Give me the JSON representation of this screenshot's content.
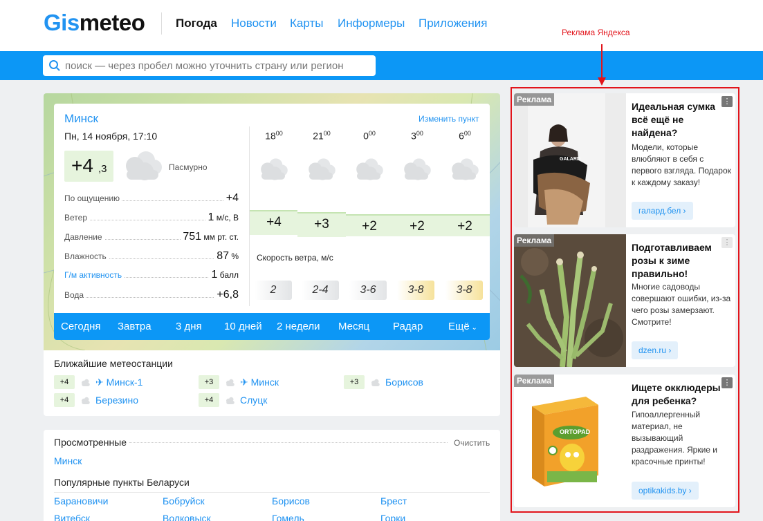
{
  "header": {
    "logo_part1": "Gis",
    "logo_part2": "meteo",
    "nav": [
      "Погода",
      "Новости",
      "Карты",
      "Информеры",
      "Приложения"
    ]
  },
  "search": {
    "placeholder": "поиск — через пробел можно уточнить страну или регион"
  },
  "weather": {
    "city": "Минск",
    "change_link": "Изменить пункт",
    "date": "Пн, 14 ноября, 17:10",
    "temp_main": "+4",
    "temp_frac": ",3",
    "condition": "Пасмурно",
    "params": [
      {
        "label": "По ощущению",
        "value": "+4",
        "unit": ""
      },
      {
        "label": "Ветер",
        "value": "1",
        "unit": " м/с, В"
      },
      {
        "label": "Давление",
        "value": "751",
        "unit": " мм рт. ст."
      },
      {
        "label": "Влажность",
        "value": "87",
        "unit": " %"
      },
      {
        "label": "Г/м активность",
        "value": "1",
        "unit": " балл"
      },
      {
        "label": "Вода",
        "value": "+6,8",
        "unit": ""
      }
    ],
    "hours": [
      {
        "h": "18",
        "m": "00"
      },
      {
        "h": "21",
        "m": "00"
      },
      {
        "h": "0",
        "m": "00"
      },
      {
        "h": "3",
        "m": "00"
      },
      {
        "h": "6",
        "m": "00"
      }
    ],
    "hour_temps": [
      "+4",
      "+3",
      "+2",
      "+2",
      "+2"
    ],
    "wind_label": "Скорость ветра, м/с",
    "wind": [
      "2",
      "2-4",
      "3-6",
      "3-8",
      "3-8"
    ],
    "tabs": [
      "Сегодня",
      "Завтра",
      "3 дня",
      "10 дней",
      "2 недели",
      "Месяц",
      "Радар",
      "Ещё"
    ]
  },
  "stations": {
    "title": "Ближайшие метеостанции",
    "items": [
      {
        "temp": "+4",
        "name": "✈ Минск-1"
      },
      {
        "temp": "+3",
        "name": "✈ Минск"
      },
      {
        "temp": "+3",
        "name": "Борисов"
      },
      {
        "temp": "+4",
        "name": "Березино"
      },
      {
        "temp": "+4",
        "name": "Слуцк"
      }
    ]
  },
  "viewed": {
    "title": "Просмотренные",
    "clear": "Очистить",
    "items": [
      "Минск"
    ]
  },
  "popular": {
    "title": "Популярные пункты Беларуси",
    "items": [
      "Барановичи",
      "Бобруйск",
      "Борисов",
      "Брест",
      "Витебск",
      "Волковыск",
      "Гомель",
      "Горки"
    ]
  },
  "annotation": "Реклама Яндекса",
  "ads": [
    {
      "tag": "Реклама",
      "title": "Идеальная сумка всё ещё не найдена?",
      "text": "Модели, которые влюбляют в себя с первого взгляда. Подарок к каждому заказу!",
      "link": "галард.бел",
      "brand": "GALARD"
    },
    {
      "tag": "Реклама",
      "title": "Подготавливаем розы к зиме правильно!",
      "text": "Многие садоводы совершают ошибки, из-за чего розы замерзают. Смотрите!",
      "link": "dzen.ru"
    },
    {
      "tag": "Реклама",
      "title": "Ищете окклюдеры для ребенка?",
      "text": "Гипоаллергенный материал, не вызывающий раздражения. Яркие и красочные принты!",
      "link": "optikakids.by",
      "brand": "ORTOPAD"
    }
  ],
  "colors": {
    "accent": "#2193f1",
    "bar": "#0c97f6",
    "warm": "#e6f4dd",
    "annotation": "#e2141b"
  }
}
